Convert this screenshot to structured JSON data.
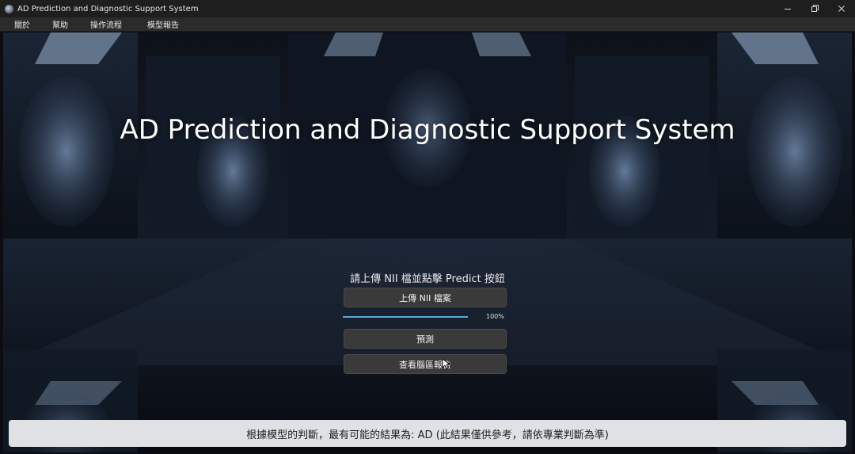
{
  "window": {
    "title": "AD Prediction and Diagnostic Support System",
    "icon": "brain-app-icon",
    "controls": [
      "minimize-icon",
      "maximize-icon",
      "close-icon"
    ]
  },
  "menu": {
    "items": [
      {
        "label": "關於"
      },
      {
        "label": "幫助"
      },
      {
        "label": "操作流程"
      },
      {
        "label": "模型報告"
      }
    ]
  },
  "main": {
    "title": "AD Prediction and Diagnostic Support System",
    "instruction": "請上傳 NII 檔並點擊 Predict 按鈕",
    "upload_button": "上傳 NII 檔案",
    "progress": {
      "value": 1.0,
      "label": "100%"
    },
    "predict_button": "預測",
    "report_button": "查看腦區報告"
  },
  "result": {
    "text": "根據模型的判斷，最有可能的結果為: AD  (此結果僅供參考，請依專業判斷為準)"
  },
  "colors": {
    "titlebar": "#1e1e1e",
    "menubar": "#2b2b2b",
    "button": "#3a3a3a",
    "progress_fill": "#5aa9d6",
    "result_bar": "#dfe1e4"
  }
}
